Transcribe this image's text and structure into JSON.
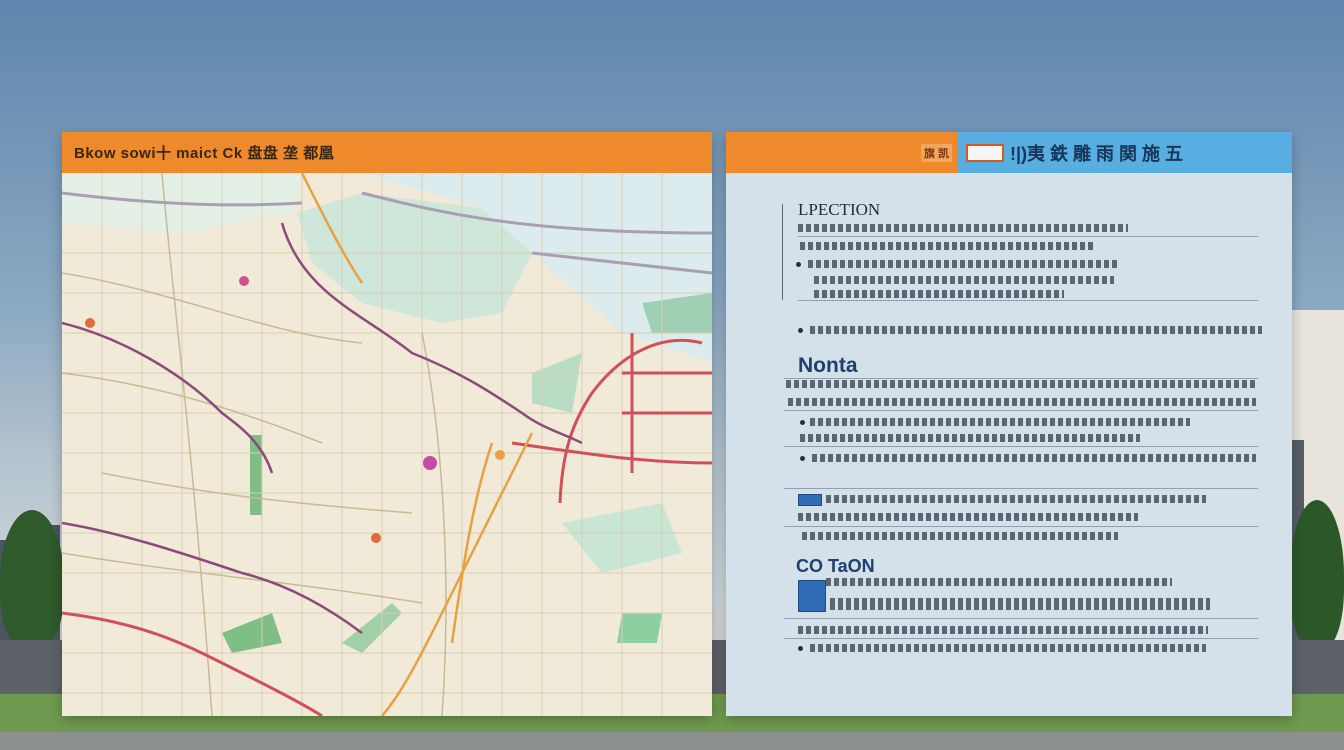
{
  "left_board": {
    "header_text": "Bkow sowi十 maict Ck 盘盘 垄 都凰"
  },
  "right_board": {
    "header_left_text": "旗 凯",
    "header_right_text": "!|)夷 鉄 雕 雨 関 施 五",
    "section_1_title": "LPECTION",
    "section_2_title": "Nonta",
    "section_3_title": "CO TaON"
  },
  "colors": {
    "header_orange": "#ef8a2c",
    "header_blue": "#58aee0",
    "title_navy": "#1f3f6e",
    "map_background": "#f1ead8",
    "map_road_red": "#d0505a",
    "map_road_purple": "#8a4a7a",
    "map_road_orange": "#e8a040",
    "map_water": "#c8e3d6"
  }
}
